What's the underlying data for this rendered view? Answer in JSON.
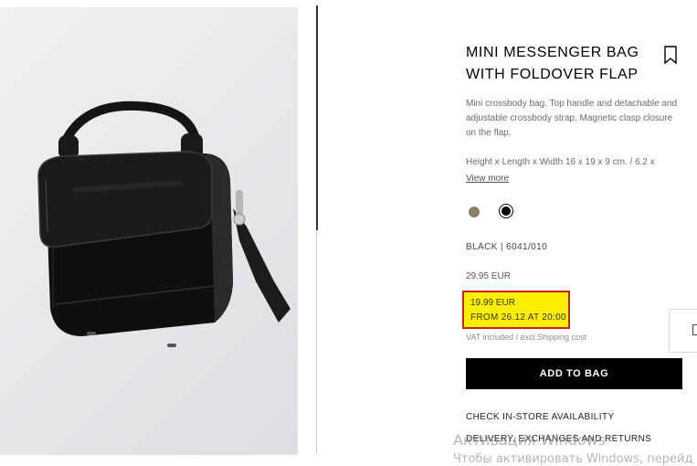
{
  "product": {
    "title_line1": "MINI MESSENGER BAG",
    "title_line2": "WITH FOLDOVER FLAP",
    "description": "Mini crossbody bag. Top handle and detachable and adjustable crossbody strap. Magnetic clasp closure on the flap.",
    "dimensions": "Height x Length x Width 16 x 19 x 9 cm. / 6.2 x",
    "view_more": "View more",
    "colors": [
      {
        "name": "beige",
        "hex": "#8c7f65",
        "selected": false
      },
      {
        "name": "black",
        "hex": "#000000",
        "selected": true
      }
    ],
    "color_ref": "BLACK | 6041/010",
    "old_price": "29.95 EUR",
    "promo_price": "19.99 EUR",
    "promo_date": "FROM 26.12 AT 20:00",
    "vat_note": "VAT included / excl.Shipping cost",
    "add_to_bag": "ADD TO BAG",
    "links": {
      "store": "CHECK IN-STORE AVAILABILITY",
      "delivery": "DELIVERY, EXCHANGES AND RETURNS"
    }
  },
  "icons": {
    "bookmark": "bookmark-icon",
    "side_tab": "side-tab-icon"
  },
  "colors": {
    "promo_highlight": "#ffee00",
    "promo_border": "#d0201a",
    "button_bg": "#000000"
  },
  "watermark": {
    "line1": "Активация Windows",
    "line2": "Чтобы активировать Windows, перейд"
  }
}
